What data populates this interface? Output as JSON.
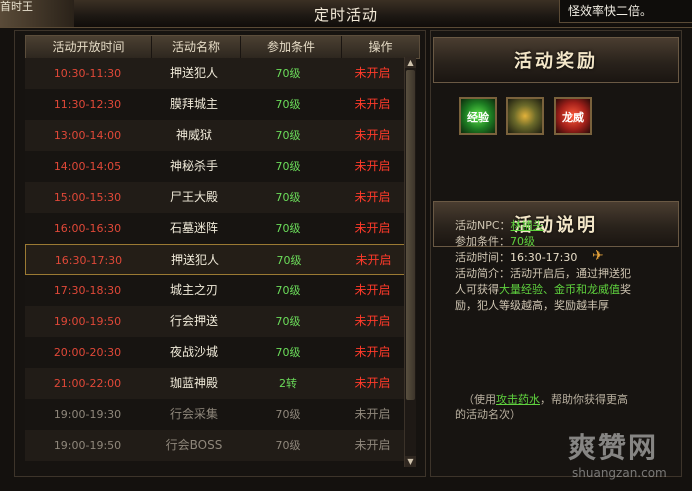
{
  "window": {
    "title": "定时活动",
    "corner_left": "首时王",
    "corner_right": "怪效率快二倍。"
  },
  "table": {
    "headers": [
      "活动开放时间",
      "活动名称",
      "参加条件",
      "操作"
    ],
    "rows": [
      {
        "time": "10:30-11:30",
        "name": "押送犯人",
        "level": "70级",
        "op": "未开启"
      },
      {
        "time": "11:30-12:30",
        "name": "膜拜城主",
        "level": "70级",
        "op": "未开启"
      },
      {
        "time": "13:00-14:00",
        "name": "神威狱",
        "level": "70级",
        "op": "未开启"
      },
      {
        "time": "14:00-14:05",
        "name": "神秘杀手",
        "level": "70级",
        "op": "未开启"
      },
      {
        "time": "15:00-15:30",
        "name": "尸王大殿",
        "level": "70级",
        "op": "未开启"
      },
      {
        "time": "16:00-16:30",
        "name": "石墓迷阵",
        "level": "70级",
        "op": "未开启"
      },
      {
        "time": "16:30-17:30",
        "name": "押送犯人",
        "level": "70级",
        "op": "未开启"
      },
      {
        "time": "17:30-18:30",
        "name": "城主之刃",
        "level": "70级",
        "op": "未开启"
      },
      {
        "time": "19:00-19:50",
        "name": "行会押送",
        "level": "70级",
        "op": "未开启"
      },
      {
        "time": "20:00-20:30",
        "name": "夜战沙城",
        "level": "70级",
        "op": "未开启"
      },
      {
        "time": "21:00-22:00",
        "name": "珈蓝神殿",
        "level": "2转",
        "op": "未开启"
      },
      {
        "time": "19:00-19:30",
        "name": "行会采集",
        "level": "70级",
        "op": "未开启"
      },
      {
        "time": "19:00-19:50",
        "name": "行会BOSS",
        "level": "70级",
        "op": "未开启"
      }
    ]
  },
  "rewards": {
    "title": "活动奖励",
    "items": [
      {
        "label": "经验",
        "icon": "exp-orb-icon"
      },
      {
        "label": "",
        "icon": "gold-coins-icon"
      },
      {
        "label": "龙威",
        "icon": "dragon-power-icon"
      }
    ]
  },
  "description": {
    "title": "活动说明",
    "npc_label": "活动NPC：",
    "npc_name": "林捕头",
    "level_label": "参加条件：",
    "level_value": "70级",
    "time_label": "活动时间：",
    "time_value": "16:30-17:30",
    "intro_label": "活动简介：",
    "intro_1": "活动开启后，通过押送犯",
    "intro_2a": "人可获得",
    "intro_2b": "大量经验、金币和龙威值",
    "intro_2c": "奖",
    "intro_3": "励，犯人等级越高，奖励越丰厚",
    "note_1a": "（使用",
    "note_1b": "攻击药水",
    "note_1c": "，帮助你获得更高",
    "note_2": "的活动名次）"
  },
  "watermark": {
    "logo": "爽赞网",
    "url": "shuangzan.com"
  },
  "colors": {
    "closed": "#ff3a2a",
    "level": "#6bdc5a",
    "time_active": "#e04838",
    "highlight_border": "#9b7a33"
  }
}
